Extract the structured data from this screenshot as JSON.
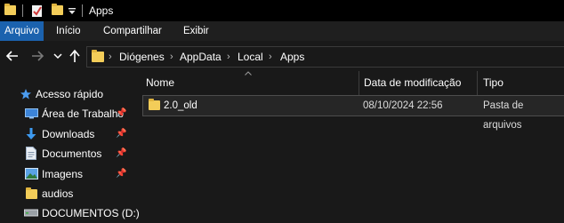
{
  "window": {
    "title": "Apps"
  },
  "ribbon": {
    "tabs": [
      {
        "label": "Arquivo",
        "active": true
      },
      {
        "label": "Início"
      },
      {
        "label": "Compartilhar"
      },
      {
        "label": "Exibir"
      }
    ]
  },
  "address": {
    "path": [
      "Diógenes",
      "AppData",
      "Local",
      "Apps"
    ]
  },
  "columns": {
    "name": "Nome",
    "modified": "Data de modificação",
    "type": "Tipo"
  },
  "files": [
    {
      "name": "2.0_old",
      "modified": "08/10/2024 22:56",
      "type": "Pasta de arquivos"
    }
  ],
  "sidebar": {
    "items": [
      {
        "label": "Acesso rápido",
        "icon": "star-icon"
      },
      {
        "label": "Área de Trabalho",
        "icon": "desktop-icon",
        "pinned": true
      },
      {
        "label": "Downloads",
        "icon": "download-icon",
        "pinned": true
      },
      {
        "label": "Documentos",
        "icon": "document-icon",
        "pinned": true
      },
      {
        "label": "Imagens",
        "icon": "image-icon",
        "pinned": true
      },
      {
        "label": "audios",
        "icon": "folder-icon"
      },
      {
        "label": "DOCUMENTOS (D:)",
        "icon": "drive-icon"
      }
    ]
  },
  "colors": {
    "accent": "#1b62ae",
    "folder": "#f3cd59",
    "background": "#191919"
  }
}
